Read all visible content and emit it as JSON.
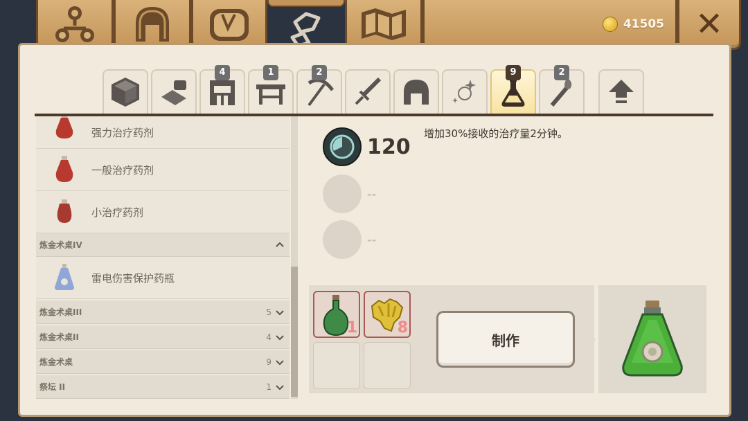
{
  "header": {
    "tabs": [
      {
        "name": "skills",
        "icon": "molecule-icon"
      },
      {
        "name": "armor",
        "icon": "helmet-icon"
      },
      {
        "name": "bag",
        "icon": "bag-icon"
      },
      {
        "name": "crafting",
        "icon": "crafting-icon",
        "active": true
      },
      {
        "name": "map",
        "icon": "map-icon"
      }
    ],
    "coins": "41505",
    "close_icon": "close-icon"
  },
  "categories": [
    {
      "icon": "cube-icon",
      "badge": ""
    },
    {
      "icon": "materials-icon",
      "badge": ""
    },
    {
      "icon": "furnace-icon",
      "badge": "4"
    },
    {
      "icon": "workbench-icon",
      "badge": "1"
    },
    {
      "icon": "pickaxe-icon",
      "badge": "2"
    },
    {
      "icon": "sword-icon",
      "badge": ""
    },
    {
      "icon": "helmet-icon",
      "badge": ""
    },
    {
      "icon": "sparkle-icon",
      "badge": ""
    },
    {
      "icon": "potion-flask-icon",
      "badge": "9",
      "active": true
    },
    {
      "icon": "torch-icon",
      "badge": "2"
    },
    {
      "icon": "upgrade-arrow-icon",
      "badge": ""
    }
  ],
  "list": {
    "items_top": [
      {
        "label": "强力治疗药剂",
        "color": "#b83a2f"
      },
      {
        "label": "一般治疗药剂",
        "color": "#b83a2f"
      },
      {
        "label": "小治疗药剂",
        "color": "#b83a2f"
      }
    ],
    "section_open": {
      "name": "炼金术桌IV",
      "chevron": "chevron-up-icon"
    },
    "section_open_items": [
      {
        "label": "雷电伤害保护药瓶",
        "color": "#8fa6d8"
      }
    ],
    "sections_collapsed": [
      {
        "name": "炼金术桌III",
        "count": "5"
      },
      {
        "name": "炼金术桌II",
        "count": "4"
      },
      {
        "name": "炼金术桌",
        "count": "9"
      },
      {
        "name": "祭坛 II",
        "count": "1"
      }
    ]
  },
  "detail": {
    "duration": "120",
    "duration_icon": "timer-icon",
    "description": "增加30%接收的治疗量2分钟。",
    "empty_stat_1": "--",
    "empty_stat_2": "--"
  },
  "recipe": {
    "ingredients": [
      {
        "name": "green-flask-icon",
        "qty": "1"
      },
      {
        "name": "yellow-ore-icon",
        "qty": "8"
      }
    ],
    "craft_label": "制作",
    "result_icon": "green-potion-icon"
  },
  "colors": {
    "panel": "#f2ebdd",
    "wood": "#c4955a",
    "accent": "#f8e3a3"
  }
}
